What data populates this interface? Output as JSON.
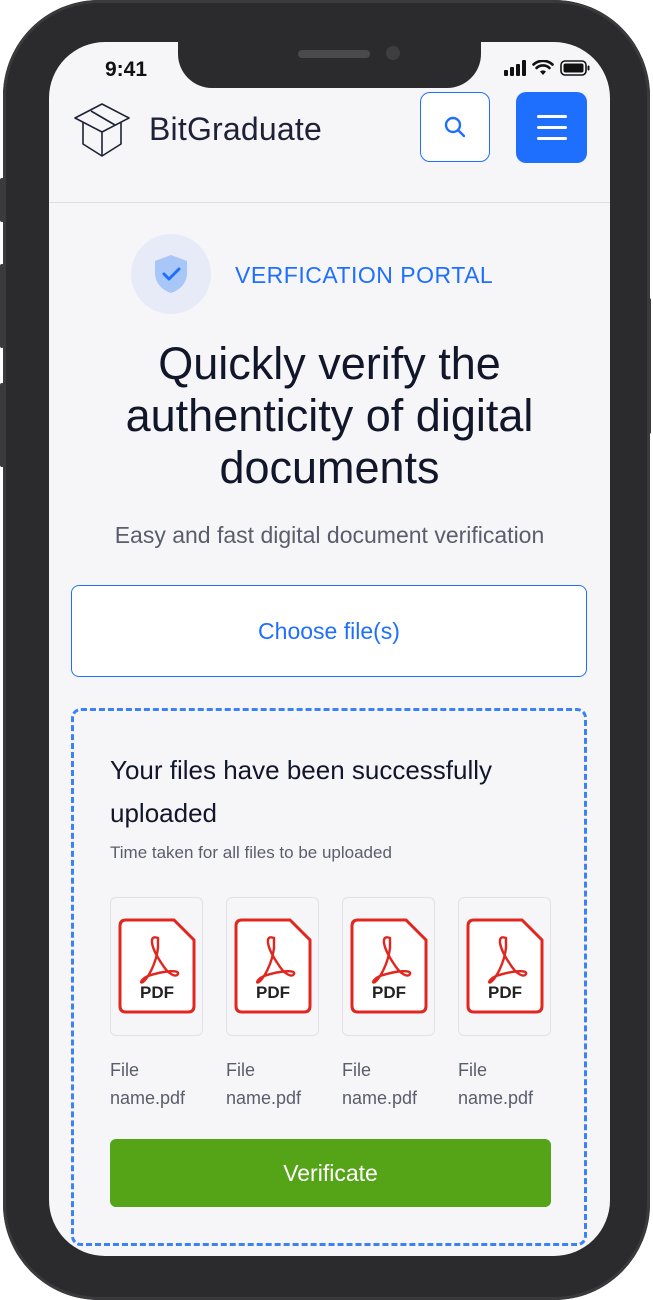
{
  "status_bar": {
    "time": "9:41"
  },
  "header": {
    "logo_text": "BitGraduate",
    "search_icon": "search-icon",
    "menu_icon": "hamburger-menu-icon",
    "accent_color": "#1f6fff"
  },
  "hero": {
    "badge_icon": "shield-check-icon",
    "portal_label": "VERFICATION PORTAL",
    "title": "Quickly verify the authenticity of digital documents",
    "subtitle": "Easy and fast digital document verification"
  },
  "upload": {
    "choose_label": "Choose file(s)",
    "success_title": "Your files have been successfully uploaded",
    "time_note": "Time taken for all files to be uploaded",
    "files": [
      {
        "icon": "pdf-file-icon",
        "icon_label": "PDF",
        "name_line1": "File",
        "name_line2": "name.pdf"
      },
      {
        "icon": "pdf-file-icon",
        "icon_label": "PDF",
        "name_line1": "File",
        "name_line2": "name.pdf"
      },
      {
        "icon": "pdf-file-icon",
        "icon_label": "PDF",
        "name_line1": "File",
        "name_line2": "name.pdf"
      },
      {
        "icon": "pdf-file-icon",
        "icon_label": "PDF",
        "name_line1": "File",
        "name_line2": "name.pdf"
      }
    ],
    "verify_label": "Verificate",
    "verify_color": "#55a418"
  }
}
